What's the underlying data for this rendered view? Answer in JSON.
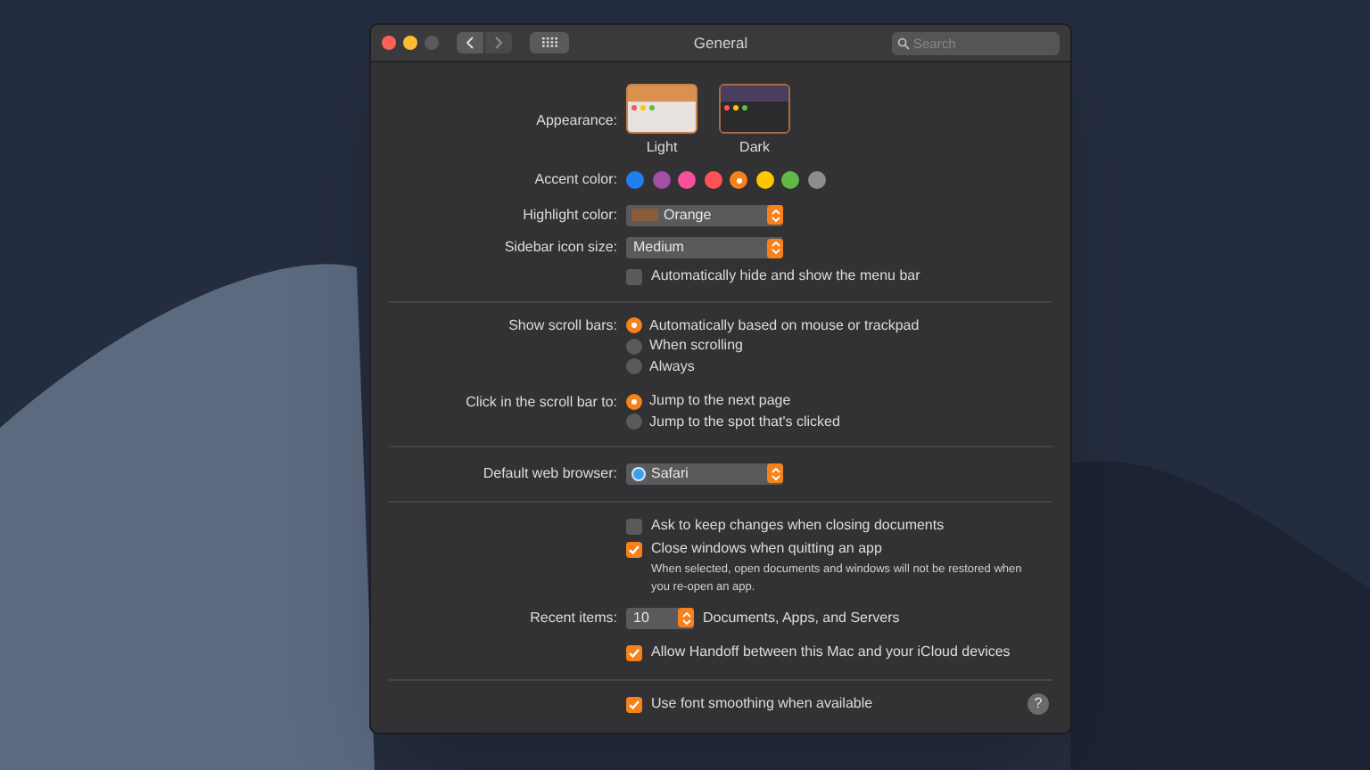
{
  "window": {
    "title": "General",
    "search": {
      "placeholder": "Search"
    },
    "nav": [
      {
        "kind": "back",
        "disabled": false
      },
      {
        "kind": "forward",
        "disabled": true
      }
    ]
  },
  "appearance": {
    "label": "Appearance:",
    "options": [
      {
        "label": "Light",
        "kind": "light",
        "selected": false
      },
      {
        "label": "Dark",
        "kind": "dark",
        "selected": true
      }
    ]
  },
  "accent": {
    "label": "Accent color:",
    "colors": [
      {
        "color": "#1f7ff0",
        "selected": false
      },
      {
        "color": "#a550a7",
        "selected": false
      },
      {
        "color": "#f74f9e",
        "selected": false
      },
      {
        "color": "#ff5257",
        "selected": false
      },
      {
        "color": "#f7821b",
        "selected": true
      },
      {
        "color": "#ffc600",
        "selected": false
      },
      {
        "color": "#62ba46",
        "selected": false
      },
      {
        "color": "#8c8c8c",
        "selected": false
      }
    ]
  },
  "highlight": {
    "label": "Highlight color:",
    "value": "Orange",
    "color": "#8a5c3c"
  },
  "sidebar_icon_size": {
    "label": "Sidebar icon size:",
    "value": "Medium"
  },
  "menu_bar": {
    "label": "Automatically hide and show the menu bar",
    "checked": false
  },
  "scroll_bars": {
    "label": "Show scroll bars:",
    "options": [
      {
        "label": "Automatically based on mouse or trackpad",
        "selected": true
      },
      {
        "label": "When scrolling",
        "selected": false
      },
      {
        "label": "Always",
        "selected": false
      }
    ]
  },
  "click_scroll": {
    "label": "Click in the scroll bar to:",
    "options": [
      {
        "label": "Jump to the next page",
        "selected": true
      },
      {
        "label": "Jump to the spot that's clicked",
        "selected": false
      }
    ]
  },
  "browser": {
    "label": "Default web browser:",
    "value": "Safari"
  },
  "ask_keep": {
    "label": "Ask to keep changes when closing documents",
    "checked": false
  },
  "close_windows": {
    "label": "Close windows when quitting an app",
    "checked": true,
    "note": "When selected, open documents and windows will not be restored when you re-open an app."
  },
  "recent_items": {
    "label": "Recent items:",
    "value": "10",
    "suffix": "Documents, Apps, and Servers"
  },
  "handoff": {
    "label": "Allow Handoff between this Mac and your iCloud devices",
    "checked": true
  },
  "font_smoothing": {
    "label": "Use font smoothing when available",
    "checked": true
  },
  "help": {
    "label": "?"
  }
}
